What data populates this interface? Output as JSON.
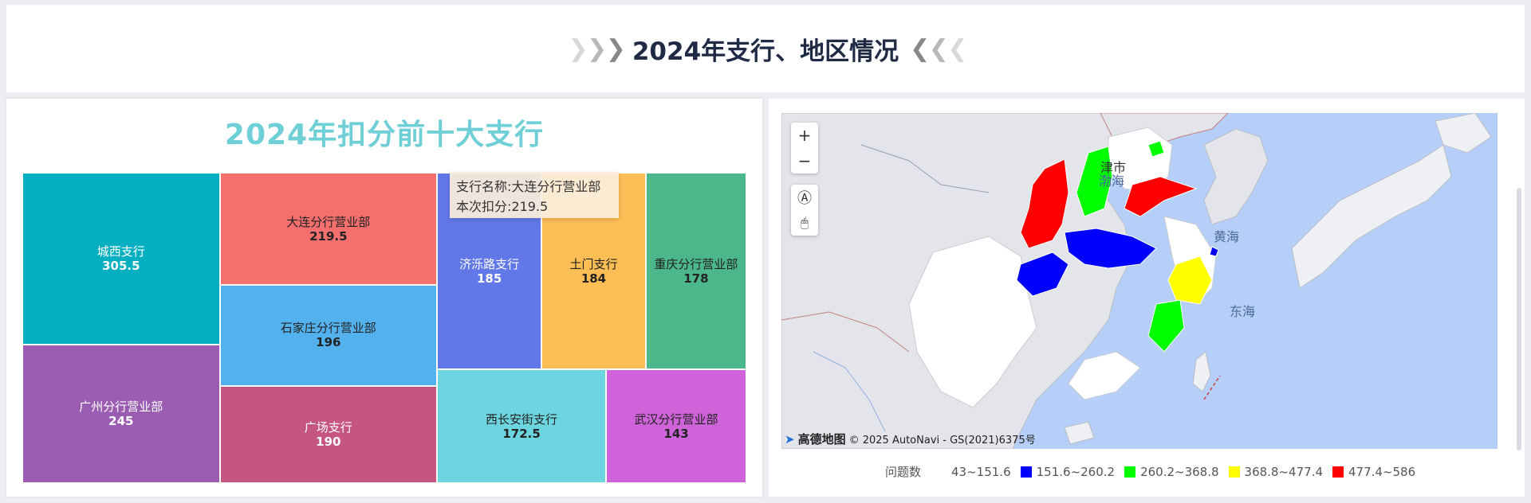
{
  "header": {
    "title": "2024年支行、地区情况",
    "left_chevrons": [
      "❯",
      "❯",
      "❯"
    ],
    "right_chevrons": [
      "❮",
      "❮",
      "❮"
    ]
  },
  "treemap": {
    "title": "2024年扣分前十大支行",
    "tooltip": {
      "name_line": "支行名称:大连分行营业部",
      "score_line": "本次扣分:219.5"
    }
  },
  "chart_data": {
    "type": "treemap",
    "title": "2024年扣分前十大支行",
    "items": [
      {
        "name": "城西支行",
        "value": 305.5,
        "color": "#04afc1"
      },
      {
        "name": "广州分行营业部",
        "value": 245,
        "color": "#9a5db1"
      },
      {
        "name": "大连分行营业部",
        "value": 219.5,
        "color": "#f4706f"
      },
      {
        "name": "石家庄分行营业部",
        "value": 196,
        "color": "#53b2ee"
      },
      {
        "name": "广场支行",
        "value": 190,
        "color": "#c45681"
      },
      {
        "name": "济泺路支行",
        "value": 185,
        "color": "#6378e8"
      },
      {
        "name": "土门支行",
        "value": 184,
        "color": "#fdbe55"
      },
      {
        "name": "重庆分行营业部",
        "value": 178,
        "color": "#4bb78b"
      },
      {
        "name": "西长安街支行",
        "value": 172.5,
        "color": "#6cd5df"
      },
      {
        "name": "武汉分行营业部",
        "value": 143,
        "color": "#cf63d9"
      }
    ]
  },
  "map": {
    "controls": {
      "zoom_in": "+",
      "zoom_out": "−",
      "compass": "Ⓐ",
      "mouse": "🖱"
    },
    "labels": {
      "bohai": "渤海",
      "huanghai": "黄海",
      "donghai": "东海",
      "city_fragment": "津市"
    },
    "attribution": {
      "logo": "高德地图",
      "text": "© 2025 AutoNavi - GS(2021)6375号"
    },
    "legend": {
      "title": "问题数",
      "items": [
        {
          "label": "43~151.6",
          "color": ""
        },
        {
          "label": "151.6~260.2",
          "color": "#0000ff"
        },
        {
          "label": "260.2~368.8",
          "color": "#00ff00"
        },
        {
          "label": "368.8~477.4",
          "color": "#ffff00"
        },
        {
          "label": "477.4~586",
          "color": "#ff0000"
        }
      ]
    },
    "colors": {
      "sea": "#b5cff8",
      "land": "#e3e5ea",
      "white_region": "#ffffff"
    }
  }
}
